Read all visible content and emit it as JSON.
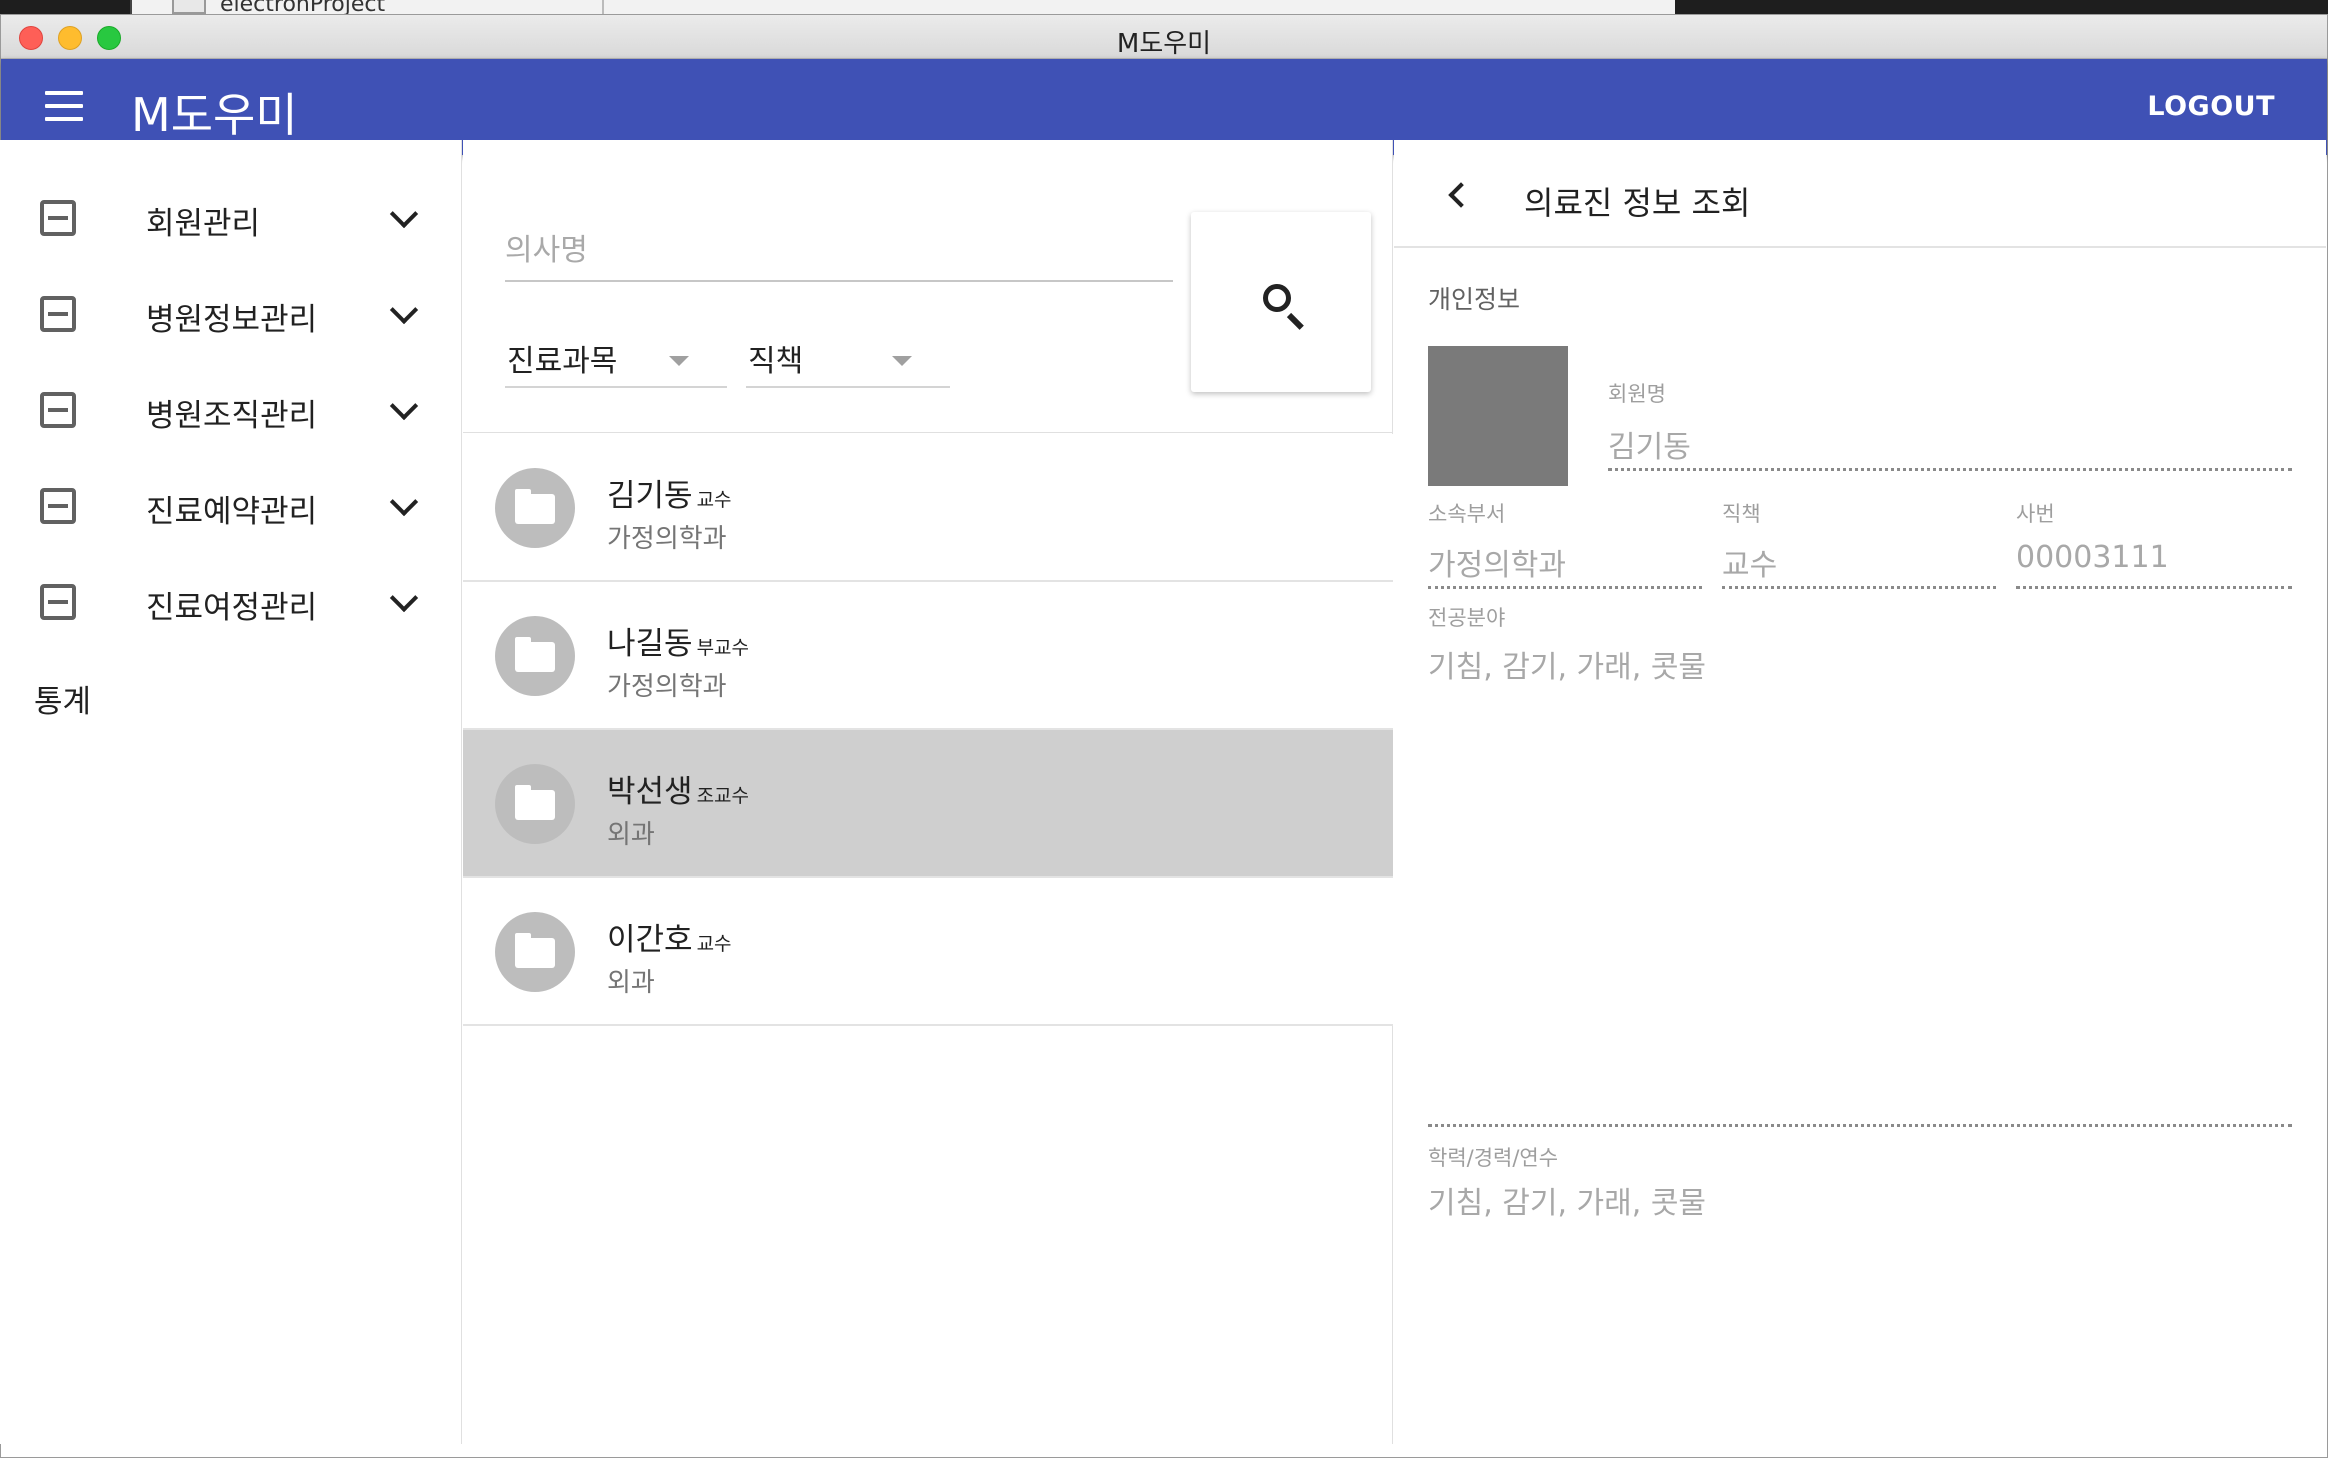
{
  "background": {
    "finder_text": "electronProject"
  },
  "window": {
    "title": "M도우미"
  },
  "appbar": {
    "title": "M도우미",
    "logout_label": "LOGOUT"
  },
  "sidebar": {
    "items": [
      {
        "label": "회원관리",
        "icon": "inbox-icon"
      },
      {
        "label": "병원정보관리",
        "icon": "inbox-icon"
      },
      {
        "label": "병원조직관리",
        "icon": "inbox-icon"
      },
      {
        "label": "진료예약관리",
        "icon": "inbox-icon"
      },
      {
        "label": "진료여정관리",
        "icon": "inbox-icon"
      }
    ],
    "stats_label": "통계"
  },
  "search": {
    "placeholder": "의사명",
    "department_select": "진료과목",
    "position_select": "직책"
  },
  "doctors": [
    {
      "name": "김기동",
      "title": "교수",
      "dept": "가정의학과"
    },
    {
      "name": "나길동",
      "title": "부교수",
      "dept": "가정의학과"
    },
    {
      "name": "박선생",
      "title": "조교수",
      "dept": "외과",
      "selected": true
    },
    {
      "name": "이간호",
      "title": "교수",
      "dept": "외과"
    }
  ],
  "detail": {
    "header": "의료진 정보 조회",
    "section": "개인정보",
    "member_name_label": "회원명",
    "member_name": "김기동",
    "dept_label": "소속부서",
    "dept": "가정의학과",
    "position_label": "직책",
    "position": "교수",
    "emp_no_label": "사번",
    "emp_no": "00003111",
    "specialty_label": "전공분야",
    "specialty": "기침, 감기, 가래, 콧물",
    "history_label": "학력/경력/연수",
    "history": "기침, 감기, 가래, 콧물"
  },
  "colors": {
    "primary": "#3f51b5",
    "selected_row": "#cfcfcf",
    "avatar": "#bdbdbd",
    "photo": "#7a7a7a"
  }
}
